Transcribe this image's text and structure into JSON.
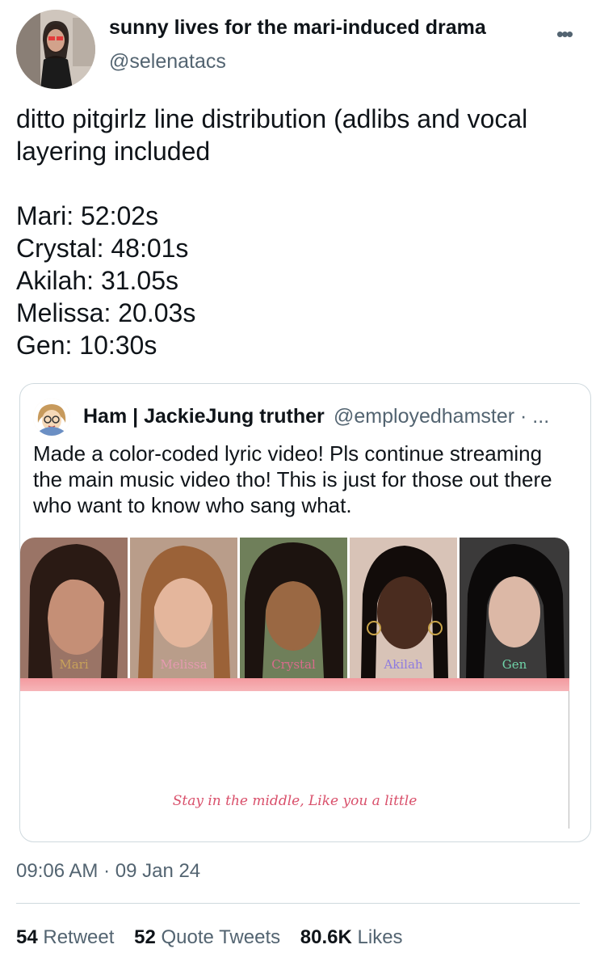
{
  "author": {
    "display_name": "sunny lives for the mari-induced drama",
    "handle": "@selenatacs",
    "avatar_icon": "profile-photo"
  },
  "more_icon": "more-horizontal-icon",
  "tweet": {
    "text_line": "ditto pitgirlz line distribution (adlibs and vocal layering included",
    "lines": [
      "Mari: 52:02s",
      "Crystal: 48:01s",
      "Akilah: 31.05s",
      "Melissa: 20.03s",
      "Gen: 10:30s"
    ]
  },
  "quote": {
    "name": "Ham | JackieJung truther",
    "handle": "@employedhamster · ...",
    "text": "Made a color-coded  lyric video! Pls continue streaming the main music video tho! This is just for those out there who want to know who sang what.",
    "members": [
      {
        "name": "Mari",
        "color": "#c8a25a"
      },
      {
        "name": "Melissa",
        "color": "#e59ab0"
      },
      {
        "name": "Crystal",
        "color": "#d96b8c"
      },
      {
        "name": "Akilah",
        "color": "#8e7be0"
      },
      {
        "name": "Gen",
        "color": "#6fd3a8"
      }
    ],
    "lyric": "Stay in the middle, Like you a little"
  },
  "timestamp": "09:06 AM · 09 Jan 24",
  "stats": {
    "retweets": "54",
    "retweets_label": "Retweet",
    "quotes": "52",
    "quotes_label": "Quote Tweets",
    "likes": "80.6K",
    "likes_label": "Likes"
  },
  "colors": {
    "accent_strip": "#f39a9f",
    "lyric": "#d9506b",
    "muted": "#536471"
  }
}
